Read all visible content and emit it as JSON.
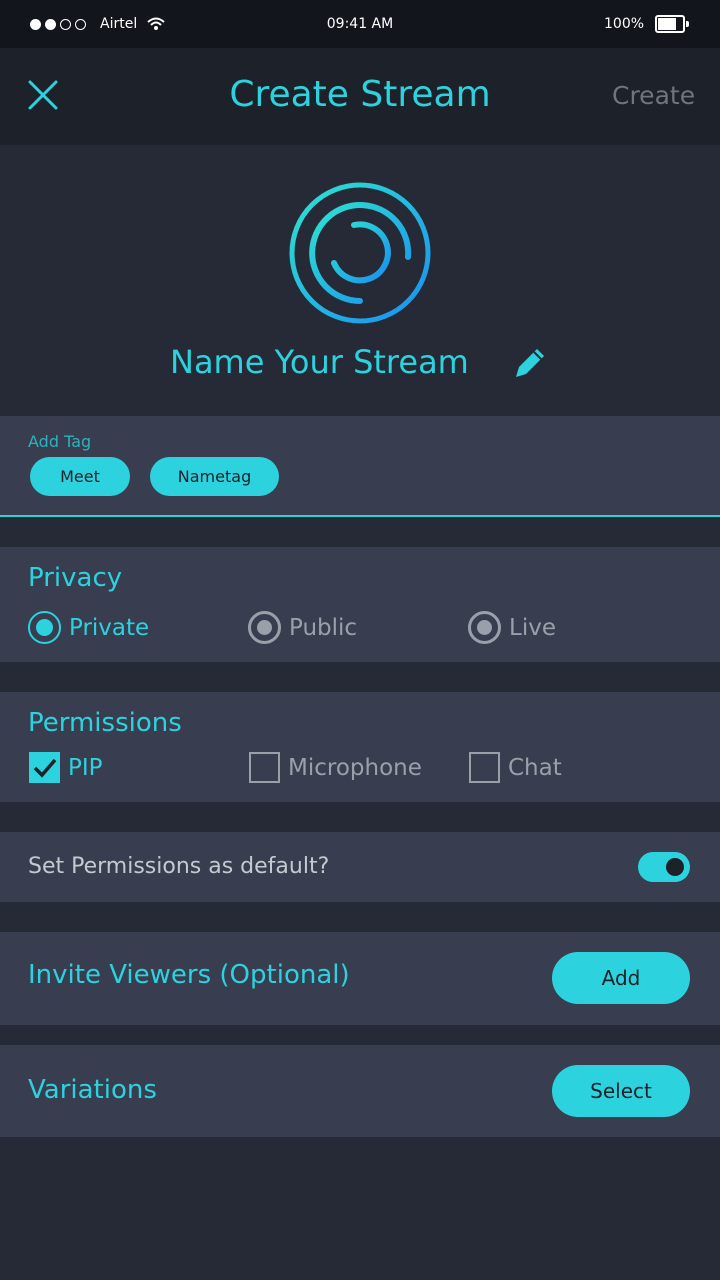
{
  "status_bar": {
    "carrier": "Airtel",
    "time": "09:41 AM",
    "battery": "100%",
    "signal_bars_filled": 2,
    "signal_bars_total": 4
  },
  "header": {
    "title": "Create Stream",
    "action_label": "Create",
    "close_icon": "close-icon"
  },
  "hero": {
    "stream_name": "Name Your Stream",
    "edit_icon": "pencil-icon"
  },
  "tags": {
    "label": "Add Tag",
    "items": [
      "Meet",
      "Nametag"
    ]
  },
  "privacy": {
    "title": "Privacy",
    "options": [
      "Private",
      "Public",
      "Live"
    ],
    "selected": "Private"
  },
  "permissions": {
    "title": "Permissions",
    "options": [
      "PIP",
      "Microphone",
      "Chat"
    ],
    "checked": [
      "PIP"
    ]
  },
  "default_permissions": {
    "label": "Set Permissions as default?",
    "enabled": true
  },
  "invite": {
    "label": "Invite Viewers (Optional)",
    "button": "Add"
  },
  "variations": {
    "label": "Variations",
    "button": "Select"
  },
  "colors": {
    "accent": "#2cd3de",
    "background": "#252a36",
    "panel": "#383e4f",
    "header": "#1d2129"
  }
}
